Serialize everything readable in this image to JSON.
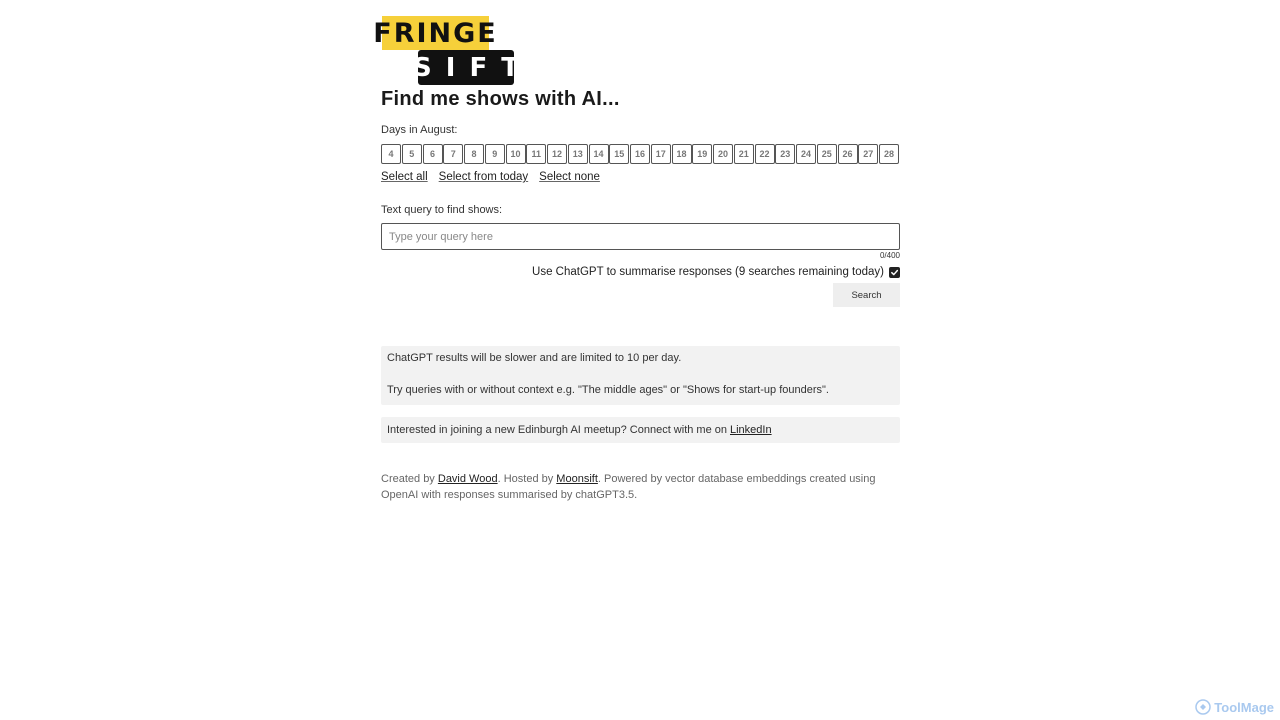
{
  "logo": {
    "top_text": "FRINGE",
    "bottom_text": "SIFT",
    "yellow": "#f6d03a",
    "black": "#111111"
  },
  "heading": "Find me shows with AI...",
  "days": {
    "label": "Days in August:",
    "items": [
      "4",
      "5",
      "6",
      "7",
      "8",
      "9",
      "10",
      "11",
      "12",
      "13",
      "14",
      "15",
      "16",
      "17",
      "18",
      "19",
      "20",
      "21",
      "22",
      "23",
      "24",
      "25",
      "26",
      "27",
      "28"
    ]
  },
  "selection_links": {
    "select_all": "Select all",
    "select_from_today": "Select from today",
    "select_none": "Select none"
  },
  "query": {
    "label": "Text query to find shows:",
    "placeholder": "Type your query here",
    "value": "",
    "counter": "0/400"
  },
  "chatgpt_option": {
    "label": "Use ChatGPT to summarise responses (9 searches remaining today)",
    "checked": true
  },
  "search_button": "Search",
  "info": {
    "line1": "ChatGPT results will be slower and are limited to 10 per day.",
    "line2": "Try queries with or without context e.g. \"The middle ages\" or \"Shows for start-up founders\".",
    "meetup_text": "Interested in joining a new Edinburgh AI meetup? Connect with me on",
    "meetup_link": "LinkedIn"
  },
  "credits": {
    "created_by": "Created by",
    "author": "David Wood",
    "hosted_by": ". Hosted by",
    "host": "Moonsift",
    "powered": ". Powered by vector database embeddings created using OpenAI with responses summarised by chatGPT3.5."
  },
  "watermark": {
    "text": "ToolMage",
    "icon": "toolmage-logo-icon"
  }
}
